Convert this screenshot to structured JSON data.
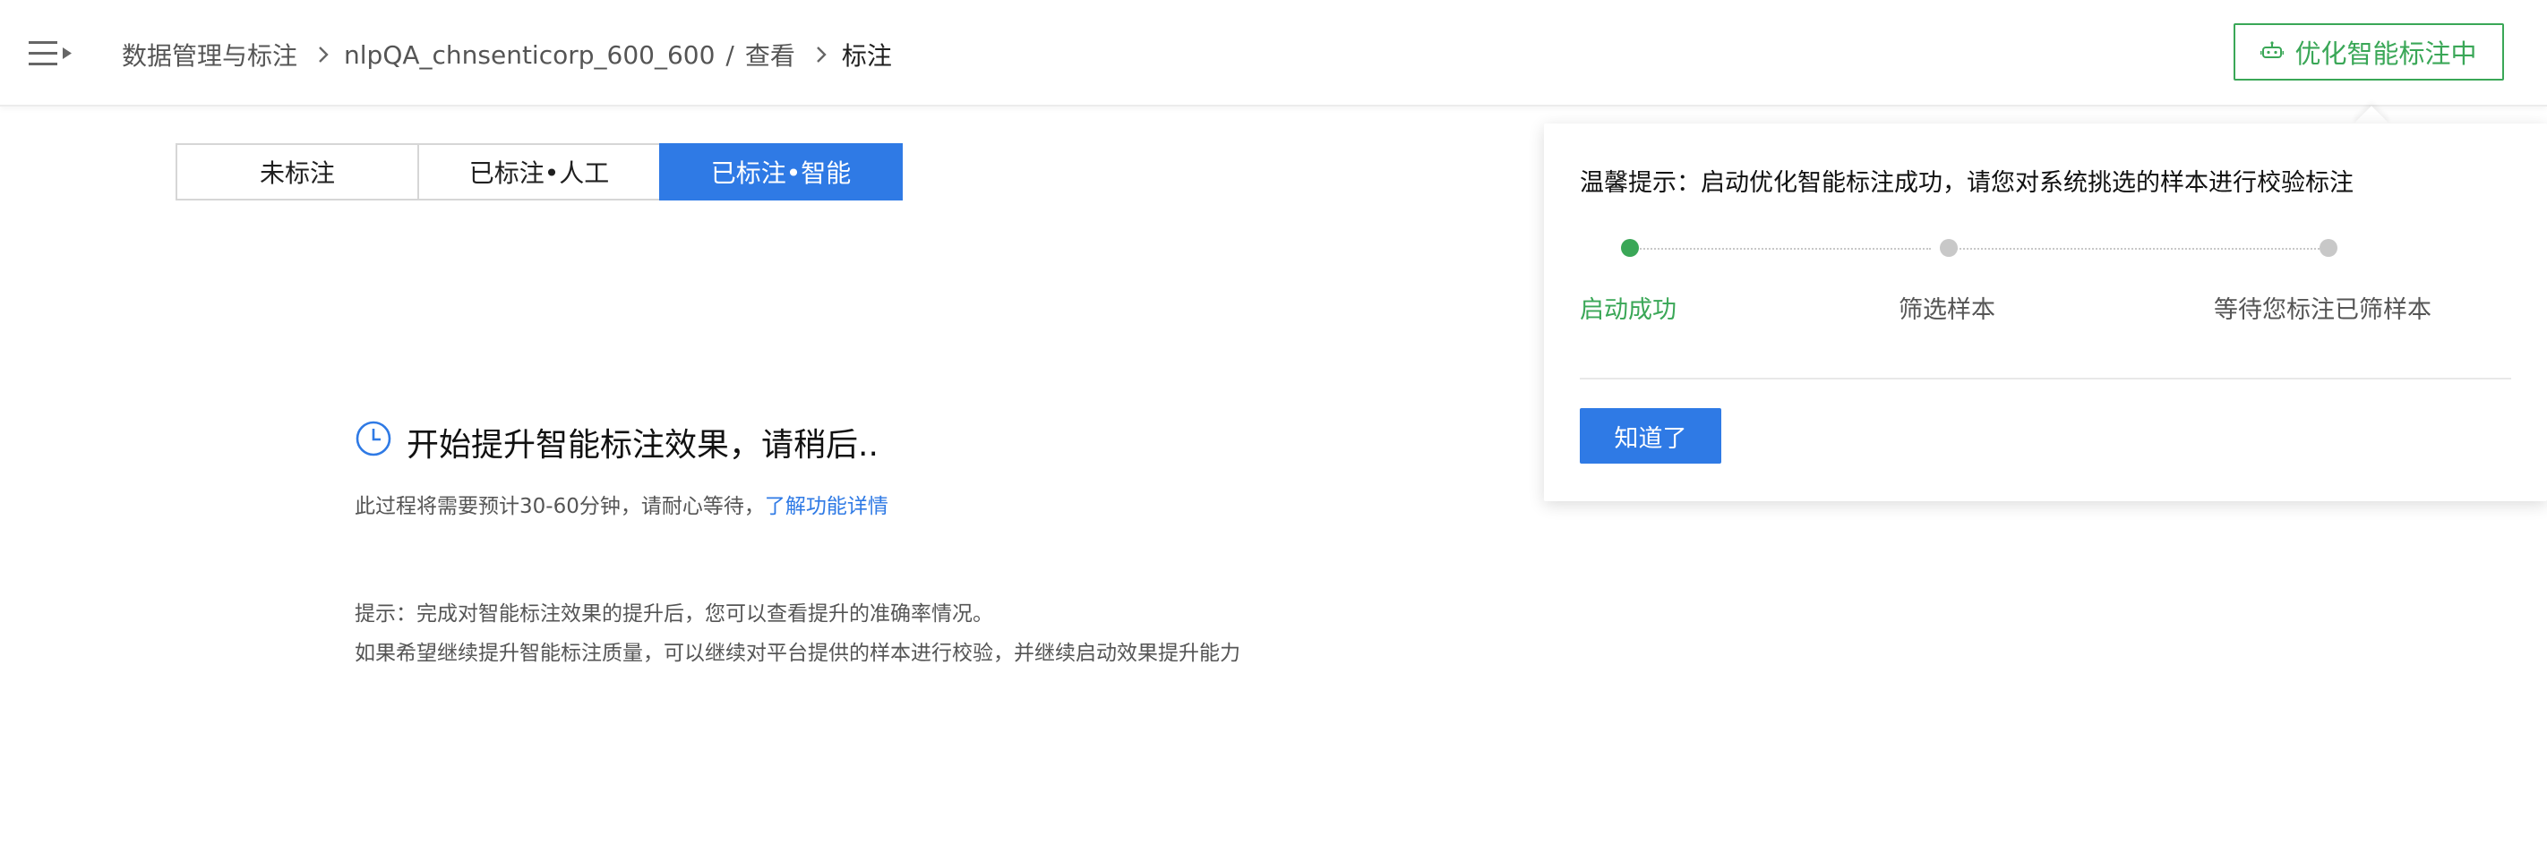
{
  "header": {
    "breadcrumb": {
      "root": "数据管理与标注",
      "dataset": "nlpQA_chnsenticorp_600_600",
      "separator": "/",
      "view": "查看",
      "current": "标注"
    },
    "optimize_button_label": "优化智能标注中"
  },
  "tabs": [
    {
      "label": "未标注",
      "active": false
    },
    {
      "label": "已标注•人工",
      "active": false
    },
    {
      "label": "已标注•智能",
      "active": true
    }
  ],
  "status": {
    "title": "开始提升智能标注效果，请稍后..",
    "description": "此过程将需要预计30-60分钟，请耐心等待，",
    "learn_more_link": "了解功能详情"
  },
  "tips": {
    "line1": "提示：完成对智能标注效果的提升后，您可以查看提升的准确率情况。",
    "line2": "如果希望继续提升智能标注质量，可以继续对平台提供的样本进行校验，并继续启动效果提升能力"
  },
  "popover": {
    "title": "温馨提示：启动优化智能标注成功，请您对系统挑选的样本进行校验标注",
    "steps": [
      {
        "label": "启动成功",
        "done": true
      },
      {
        "label": "筛选样本",
        "done": false
      },
      {
        "label": "等待您标注已筛样本",
        "done": false
      }
    ],
    "ok_button_label": "知道了"
  },
  "colors": {
    "primary_blue": "#2f7ae5",
    "success_green": "#3aa757",
    "text_muted": "#555555"
  },
  "icons": {
    "menu": "menu-toggle-icon",
    "chevron": "chevron-right-icon",
    "robot": "robot-icon",
    "clock": "clock-icon"
  }
}
